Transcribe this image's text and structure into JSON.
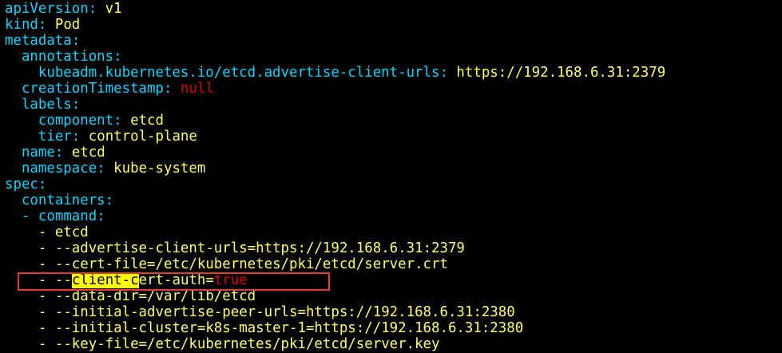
{
  "lines": {
    "l1": {
      "key": "apiVersion",
      "value": "v1"
    },
    "l2": {
      "key": "kind",
      "value": "Pod"
    },
    "l3": {
      "key": "metadata"
    },
    "l4": {
      "key": "annotations"
    },
    "l5": {
      "key": "kubeadm.kubernetes.io/etcd.advertise-client-urls",
      "value": "https://192.168.6.31:2379"
    },
    "l6": {
      "key": "creationTimestamp",
      "value": "null"
    },
    "l7": {
      "key": "labels"
    },
    "l8": {
      "key": "component",
      "value": "etcd"
    },
    "l9": {
      "key": "tier",
      "value": "control-plane"
    },
    "l10": {
      "key": "name",
      "value": "etcd"
    },
    "l11": {
      "key": "namespace",
      "value": "kube-system"
    },
    "l12": {
      "key": "spec"
    },
    "l13": {
      "key": "containers"
    },
    "l14": {
      "dash": "-",
      "key": "command"
    },
    "l15": {
      "dash": "-",
      "value": "etcd"
    },
    "l16": {
      "dash": "-",
      "value": "--advertise-client-urls=https://192.168.6.31:2379"
    },
    "l17": {
      "dash": "-",
      "value": "--cert-file=/etc/kubernetes/pki/etcd/server.crt"
    },
    "l18": {
      "dash": "-",
      "prefix": "--",
      "highlighted": "client-",
      "cursor_char": "c",
      "rest": "ert-auth=",
      "bool": "true"
    },
    "l19": {
      "dash": "-",
      "value": "--data-dir=/var/lib/etcd"
    },
    "l20": {
      "dash": "-",
      "value": "--initial-advertise-peer-urls=https://192.168.6.31:2380"
    },
    "l21": {
      "dash": "-",
      "value": "--initial-cluster=k8s-master-1=https://192.168.6.31:2380"
    },
    "l22": {
      "dash": "-",
      "value": "--key-file=/etc/kubernetes/pki/etcd/server.key"
    }
  },
  "punctuation": {
    "colon": ":"
  },
  "colors": {
    "background": "#000000",
    "key": "#00d7ff",
    "value": "#ffff5f",
    "null_and_bool": "#d70000",
    "search_highlight": "#ffff00",
    "annotation_box": "#e53935"
  }
}
